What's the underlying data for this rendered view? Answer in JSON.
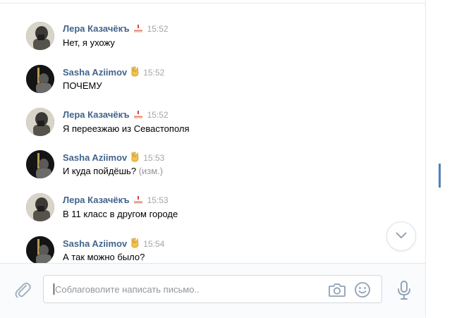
{
  "messages": [
    {
      "author": "Лера Казачёкъ",
      "emoji": "cake-icon",
      "time": "15:52",
      "text": "Нет, я ухожу",
      "edited": ""
    },
    {
      "author": "Sasha Aziimov",
      "emoji": "victory-hand-icon",
      "time": "15:52",
      "text": "ПОЧЕМУ",
      "edited": ""
    },
    {
      "author": "Лера Казачёкъ",
      "emoji": "cake-icon",
      "time": "15:52",
      "text": "Я переезжаю из Севастополя",
      "edited": ""
    },
    {
      "author": "Sasha Aziimov",
      "emoji": "victory-hand-icon",
      "time": "15:53",
      "text": "И куда пойдёшь?",
      "edited": " (изм.)"
    },
    {
      "author": "Лера Казачёкъ",
      "emoji": "cake-icon",
      "time": "15:53",
      "text": "В 11 класс в другом городе",
      "edited": ""
    },
    {
      "author": "Sasha Aziimov",
      "emoji": "victory-hand-icon",
      "time": "15:54",
      "text": "А так можно было?",
      "edited": ""
    }
  ],
  "composer": {
    "placeholder": "Соблаговолите написать письмо..",
    "value": ""
  },
  "colors": {
    "author": "#42648b",
    "time": "#a2a5a8",
    "accent": "#5181b8"
  }
}
